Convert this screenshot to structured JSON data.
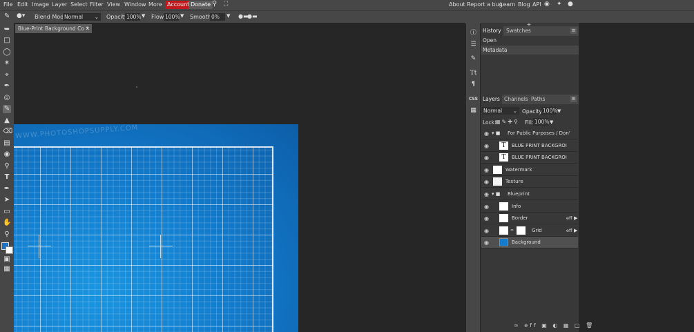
{
  "menu": {
    "items": [
      "File",
      "Edit",
      "Image",
      "Layer",
      "Select",
      "Filter",
      "View",
      "Window",
      "More"
    ],
    "account": "Account",
    "donate": "Donate",
    "right_links": [
      "About",
      "Report a bug",
      "Learn",
      "Blog",
      "API"
    ],
    "account_color": "#c0181c"
  },
  "options": {
    "blend_label": "Blend Mode:",
    "blend_value": "Normal",
    "opacity_label": "Opacity:",
    "opacity_value": "100%",
    "flow_label": "Flow:",
    "flow_value": "100%",
    "smooth_label": "Smooth:",
    "smooth_value": "0%"
  },
  "document": {
    "tab_title": "Blue-Print Background Co",
    "tab_modified": "*",
    "close": "✕",
    "watermark_text": "WWW.PHOTOSHOPSUPPLY.COM"
  },
  "history_panel": {
    "tabs": [
      "History",
      "Swatches"
    ],
    "items": [
      "Open",
      "Metadata"
    ]
  },
  "layers_panel": {
    "tabs": [
      "Layers",
      "Channels",
      "Paths"
    ],
    "blend_value": "Normal",
    "opacity_label": "Opacity:",
    "opacity_value": "100%",
    "lock_label": "Lock:",
    "fill_label": "Fill:",
    "fill_value": "100%",
    "layers": [
      {
        "name": "For Public Purposes / Don'",
        "kind": "folder"
      },
      {
        "name": "BLUE PRINT BACKGROI",
        "kind": "text"
      },
      {
        "name": "BLUE PRINT BACKGROI",
        "kind": "text"
      },
      {
        "name": "Watermark",
        "kind": "raster"
      },
      {
        "name": "Texture",
        "kind": "raster"
      },
      {
        "name": "Blueprint",
        "kind": "folder"
      },
      {
        "name": "Info",
        "kind": "raster"
      },
      {
        "name": "Border",
        "kind": "raster",
        "fx": "eff"
      },
      {
        "name": "Grid",
        "kind": "raster-mask",
        "fx": "eff"
      },
      {
        "name": "Background",
        "kind": "raster",
        "selected": true
      }
    ]
  },
  "side_icons": {
    "css_label": "CSS"
  },
  "colors": {
    "canvas_blue": "#137ccd",
    "foreground": "#1a73c9"
  }
}
